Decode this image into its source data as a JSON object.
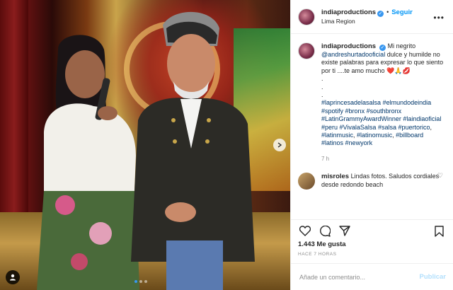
{
  "post": {
    "author": "indiaproductions",
    "follow_label": "Seguir",
    "location": "Lima Region",
    "caption": {
      "username": "indiaproductions",
      "intro": "Mi negrito",
      "mention": "@andreshurtadooficial",
      "body": "dulce y humilde no existe palabras para expresar lo que siento por ti ....te amo mucho",
      "emoji": "❤️🙏💋",
      "dots": [
        ".",
        ".",
        "."
      ],
      "hashtags": [
        "#laprincesadelasalsa",
        "#elmundodeindia",
        "#spotify",
        "#bronx",
        "#southbronx",
        "#LatinGrammyAwardWinner",
        "#laindiaoficial",
        "#peru",
        "#VivalaSalsa",
        "#salsa",
        "#puertorico",
        "#latinmusic",
        "#latinomusic",
        "#billboard",
        "#latinos",
        "#newyork"
      ],
      "time": "7 h"
    },
    "comment": {
      "username": "misroles",
      "text": "Lindas fotos. Saludos cordiales desde redondo beach"
    },
    "likes": "1.443 Me gusta",
    "posted_ago": "HACE 7 HORAS",
    "add_comment_placeholder": "Añade un comentario...",
    "publish_label": "Publicar"
  },
  "icons": {
    "like": "heart-icon",
    "comment": "comment-icon",
    "share": "share-icon",
    "save": "bookmark-icon",
    "tag": "user-tag-icon",
    "next": "chevron-right-icon",
    "verified": "verified-icon",
    "more": "more-icon"
  },
  "colors": {
    "accent": "#0095f6",
    "link": "#00376b",
    "heart": "#ed4956"
  }
}
